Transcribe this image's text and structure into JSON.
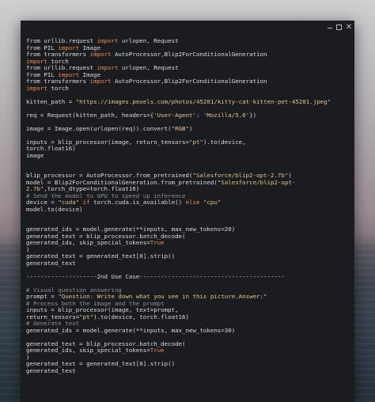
{
  "window": {
    "controls": {
      "minimize_icon": "minimize-icon",
      "maximize_icon": "maximize-icon",
      "close_icon": "close-icon",
      "close_glyph": "✕"
    }
  },
  "editor": {
    "lines": [
      [
        {
          "t": "from "
        },
        {
          "t": "urllib.request"
        },
        {
          "t": " import ",
          "c": "kw"
        },
        {
          "t": "urlopen, Request"
        }
      ],
      [
        {
          "t": "from "
        },
        {
          "t": "PIL"
        },
        {
          "t": " import ",
          "c": "kw"
        },
        {
          "t": "Image"
        }
      ],
      [
        {
          "t": "from "
        },
        {
          "t": "transformers"
        },
        {
          "t": " import ",
          "c": "kw"
        },
        {
          "t": "AutoProcessor,Blip2ForConditionalGeneration"
        }
      ],
      [
        {
          "t": "import ",
          "c": "kw"
        },
        {
          "t": "torch"
        }
      ],
      [
        {
          "t": "from "
        },
        {
          "t": "urllib.request"
        },
        {
          "t": " import ",
          "c": "kw"
        },
        {
          "t": "urlopen, Request"
        }
      ],
      [
        {
          "t": "from "
        },
        {
          "t": "PIL"
        },
        {
          "t": " import ",
          "c": "kw"
        },
        {
          "t": "Image"
        }
      ],
      [
        {
          "t": "from "
        },
        {
          "t": "transformers"
        },
        {
          "t": " import ",
          "c": "kw"
        },
        {
          "t": "AutoProcessor,Blip2ForConditionalGeneration"
        }
      ],
      [
        {
          "t": "import ",
          "c": "kw"
        },
        {
          "t": "torch"
        }
      ],
      [],
      [
        {
          "t": "kitten_path = "
        },
        {
          "t": "\"https://images.pexels.com/photos/45201/kitty-cat-kitten-pet-45201.jpeg\"",
          "c": "str"
        }
      ],
      [],
      [
        {
          "t": "req = Request(kitten_path, headers={"
        },
        {
          "t": "'User-Agent'",
          "c": "str"
        },
        {
          "t": ": "
        },
        {
          "t": "'Mozilla/5.0'",
          "c": "str"
        },
        {
          "t": "})"
        }
      ],
      [],
      [
        {
          "t": "image = Image.open(urlopen(req)).convert("
        },
        {
          "t": "\"RGB\"",
          "c": "str"
        },
        {
          "t": ")"
        }
      ],
      [],
      [
        {
          "t": "inputs = blip_processor(image, return_tensors="
        },
        {
          "t": "\"pt\"",
          "c": "str"
        },
        {
          "t": ").to(device,"
        }
      ],
      [
        {
          "t": "torch.float16)"
        }
      ],
      [
        {
          "t": "image"
        }
      ],
      [],
      [],
      [
        {
          "t": "blip_processor = AutoProcessor.from_pretrained("
        },
        {
          "t": "\"Salesforce/blip2-opt-2.7b\"",
          "c": "str"
        },
        {
          "t": ")"
        }
      ],
      [
        {
          "t": "model = Blip2ForConditionalGeneration.from_pretrained("
        },
        {
          "t": "\"Salesforce/blip2-opt-",
          "c": "str"
        }
      ],
      [
        {
          "t": "2.7b\"",
          "c": "str"
        },
        {
          "t": ",torch_dtype=torch.float16)"
        }
      ],
      [
        {
          "t": "# Send the model to GPU to speed up inference",
          "c": "cm"
        }
      ],
      [
        {
          "t": "device = "
        },
        {
          "t": "\"cuda\"",
          "c": "str"
        },
        {
          "t": " if ",
          "c": "kw"
        },
        {
          "t": "torch.cuda.is_available() "
        },
        {
          "t": "else",
          "c": "kw"
        },
        {
          "t": " "
        },
        {
          "t": "\"cpu\"",
          "c": "str"
        }
      ],
      [
        {
          "t": "model.to(device)"
        }
      ],
      [],
      [],
      [
        {
          "t": "generated_ids = model.generate(**inputs, max_new_tokens=20)"
        }
      ],
      [
        {
          "t": "generated_text = blip_processor.batch_decode("
        }
      ],
      [
        {
          "t": "generated_ids, skip_special_tokens="
        },
        {
          "t": "True",
          "c": "kw"
        }
      ],
      [
        {
          "t": ")"
        }
      ],
      [
        {
          "t": "generated_text = generated_text[0].strip()"
        }
      ],
      [
        {
          "t": "generated_text"
        }
      ],
      [],
      [
        {
          "t": "--------------------2nd Use Case-----------------------------------------"
        }
      ],
      [],
      [
        {
          "t": "# Visual question answering",
          "c": "cm"
        }
      ],
      [
        {
          "t": "prompt = "
        },
        {
          "t": "\"Question: Write down what you see in this picture.Answer:\"",
          "c": "str"
        }
      ],
      [
        {
          "t": "# Process both the image and the prompt",
          "c": "cm"
        }
      ],
      [
        {
          "t": "inputs = blip_processor(image, text=prompt,"
        }
      ],
      [
        {
          "t": "return_tensors="
        },
        {
          "t": "\"pt\"",
          "c": "str"
        },
        {
          "t": ").to(device, torch.float16)"
        }
      ],
      [
        {
          "t": "# Generate text",
          "c": "cm"
        }
      ],
      [
        {
          "t": "generated_ids = model.generate(**inputs, max_new_tokens=30)"
        }
      ],
      [],
      [
        {
          "t": "generated_text = blip_processor.batch_decode("
        }
      ],
      [
        {
          "t": "generated_ids, skip_special_tokens="
        },
        {
          "t": "True",
          "c": "kw"
        }
      ],
      [
        {
          "t": ")"
        }
      ],
      [
        {
          "t": "generated_text = generated_text[0].strip()"
        }
      ],
      [
        {
          "t": "generated_text"
        }
      ]
    ]
  },
  "colors": {
    "keyword": "#ef8c4c",
    "string": "#e6c58a",
    "comment": "#8a8f98",
    "text": "#d9dbe0",
    "window_bg": "#1a1c20"
  }
}
